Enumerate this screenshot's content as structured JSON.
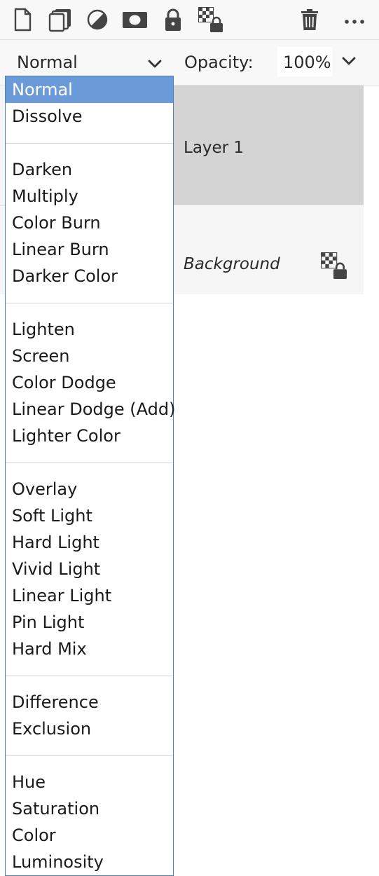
{
  "toolbar": {
    "icons": [
      {
        "name": "new-layer-icon"
      },
      {
        "name": "duplicate-layer-icon"
      },
      {
        "name": "adjustment-layer-icon"
      },
      {
        "name": "layer-mask-icon"
      },
      {
        "name": "lock-icon"
      },
      {
        "name": "lock-transparency-icon"
      },
      {
        "name": "trash-icon"
      },
      {
        "name": "more-icon"
      }
    ]
  },
  "blend": {
    "current": "Normal",
    "opacity_label": "Opacity:",
    "opacity_value": "100%"
  },
  "layers": [
    {
      "name": "Layer 1",
      "selected": true
    },
    {
      "name": "Background",
      "locked": true
    }
  ],
  "dropdown": {
    "selected": "Normal",
    "groups": [
      [
        "Normal",
        "Dissolve"
      ],
      [
        "Darken",
        "Multiply",
        "Color Burn",
        "Linear Burn",
        "Darker Color"
      ],
      [
        "Lighten",
        "Screen",
        "Color Dodge",
        "Linear Dodge (Add)",
        "Lighter Color"
      ],
      [
        "Overlay",
        "Soft Light",
        "Hard Light",
        "Vivid Light",
        "Linear Light",
        "Pin Light",
        "Hard Mix"
      ],
      [
        "Difference",
        "Exclusion"
      ],
      [
        "Hue",
        "Saturation",
        "Color",
        "Luminosity"
      ]
    ]
  },
  "colors": {
    "selection": "#6b9ad8",
    "dropdown_border": "#4a7fc0",
    "layer_selected": "#d4d4d4"
  }
}
